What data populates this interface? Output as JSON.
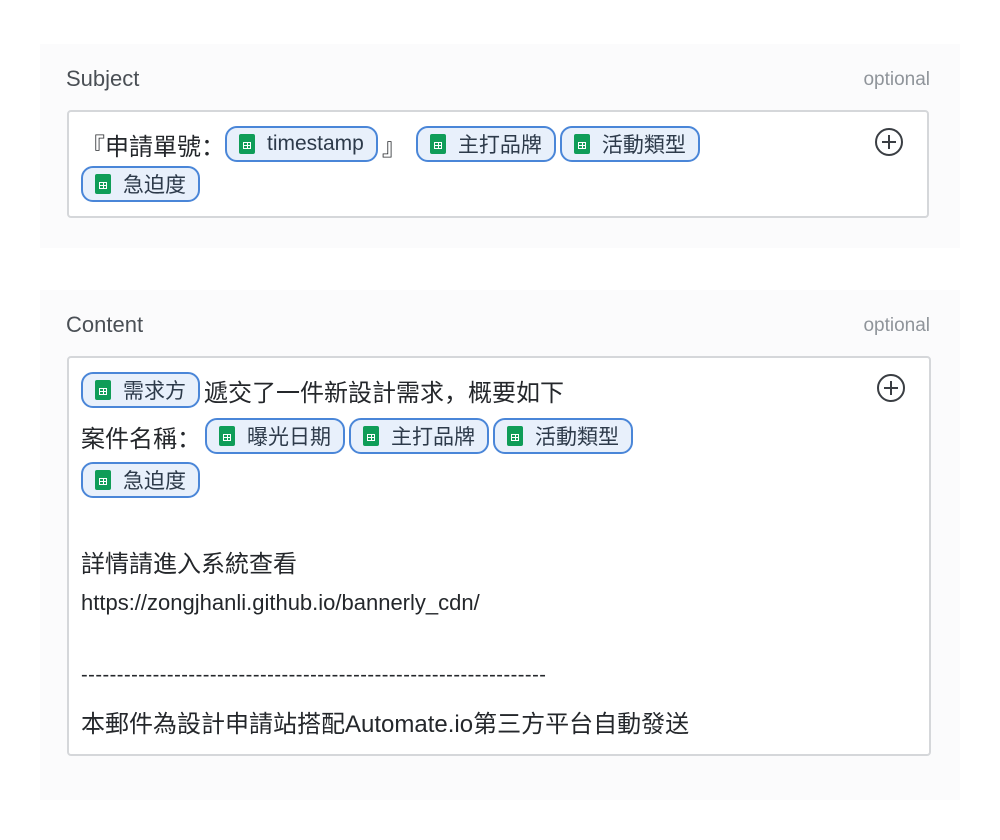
{
  "subject": {
    "label": "Subject",
    "optional": "optional",
    "prefix": "『申請單號：",
    "suffix": "』",
    "tokens": [
      "timestamp",
      "主打品牌",
      "活動類型",
      "急迫度"
    ]
  },
  "content": {
    "label": "Content",
    "optional": "optional",
    "line1_token": "需求方",
    "line1_text": "遞交了一件新設計需求，概要如下",
    "line2_text": "案件名稱：",
    "line2_tokens": [
      "曝光日期",
      "主打品牌",
      "活動類型"
    ],
    "line3_token": "急迫度",
    "details_text": "詳情請進入系統查看",
    "url": "https://zongjhanli.github.io/bannerly_cdn/",
    "separator": "-----------------------------------------------------------------",
    "footer": "本郵件為設計申請站搭配Automate.io第三方平台自動發送"
  },
  "icons": {
    "token_icon": "google-sheets-icon",
    "add_icon": "plus-circle-icon"
  },
  "colors": {
    "token_border": "#4a86d8",
    "token_bg": "#e8f0fb",
    "sheets_green": "#0f9d58"
  }
}
